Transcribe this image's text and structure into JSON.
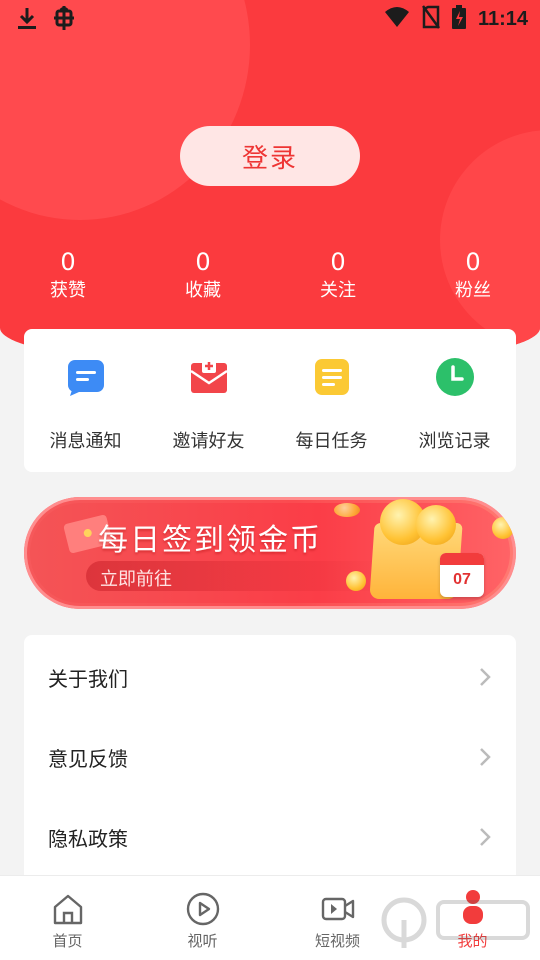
{
  "status_bar": {
    "time": "11:14",
    "left_icons": [
      "download-icon",
      "bug-icon"
    ],
    "right_icons": [
      "wifi-icon",
      "no-sim-icon",
      "battery-charging-icon"
    ]
  },
  "login": {
    "label": "登录"
  },
  "stats": [
    {
      "value": "0",
      "label": "获赞"
    },
    {
      "value": "0",
      "label": "收藏"
    },
    {
      "value": "0",
      "label": "关注"
    },
    {
      "value": "0",
      "label": "粉丝"
    }
  ],
  "actions": [
    {
      "label": "消息通知",
      "icon": "message-icon",
      "color": "#3d8bf5"
    },
    {
      "label": "邀请好友",
      "icon": "invite-mail-icon",
      "color": "#f2454a"
    },
    {
      "label": "每日任务",
      "icon": "task-list-icon",
      "color": "#fbc934"
    },
    {
      "label": "浏览记录",
      "icon": "history-clock-icon",
      "color": "#2cc06a"
    }
  ],
  "banner": {
    "title": "每日签到领金币",
    "subtitle": "立即前往",
    "calendar_day": "07"
  },
  "menu": [
    {
      "label": "关于我们"
    },
    {
      "label": "意见反馈"
    },
    {
      "label": "隐私政策"
    }
  ],
  "nav": [
    {
      "label": "首页",
      "icon": "home-icon"
    },
    {
      "label": "视听",
      "icon": "play-circle-icon"
    },
    {
      "label": "短视频",
      "icon": "video-camera-icon"
    },
    {
      "label": "我的",
      "icon": "profile-icon",
      "active": true
    }
  ],
  "colors": {
    "primary": "#fb3a3e",
    "login_text": "#ee3534",
    "nav_active": "#f23c3c"
  }
}
